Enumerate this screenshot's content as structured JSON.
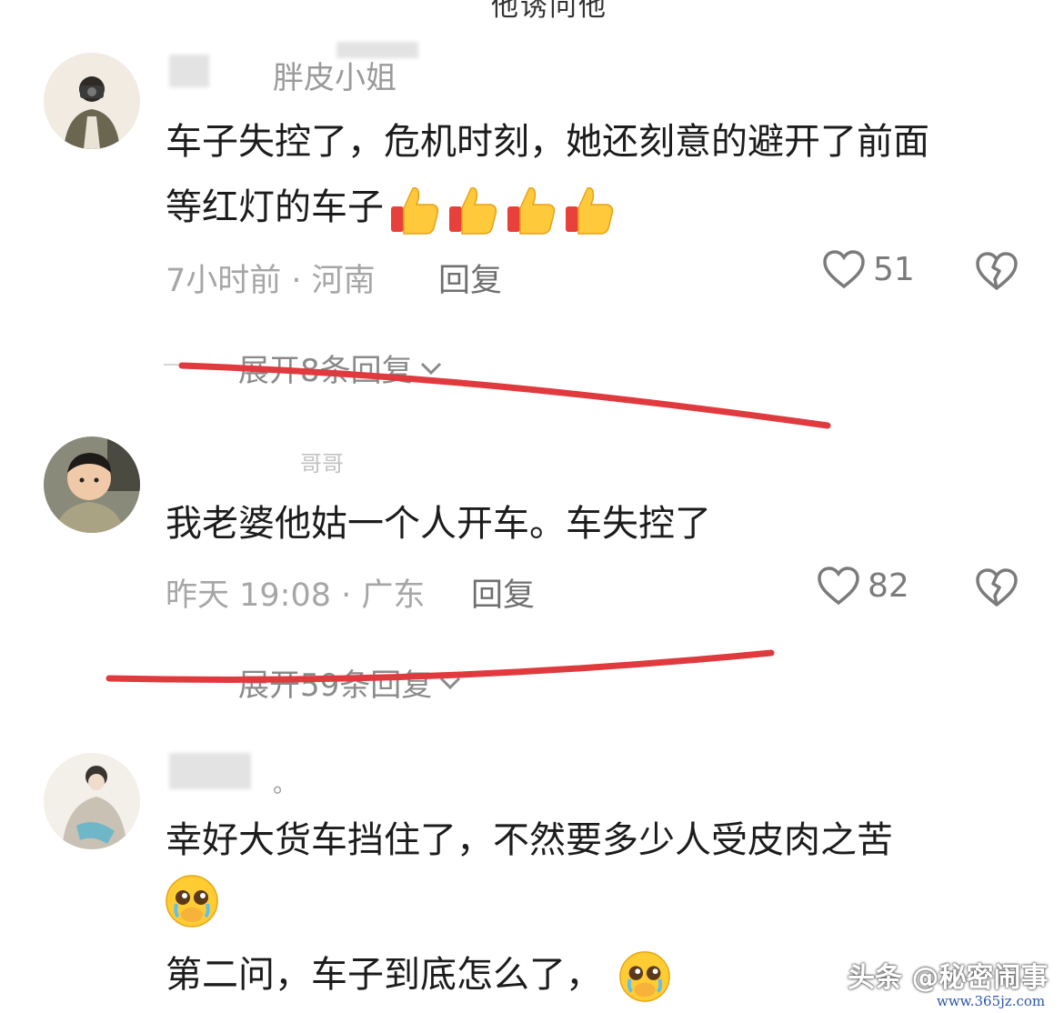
{
  "top_fragment": "他诱问他",
  "comments": [
    {
      "username": "胖皮小姐",
      "text_lines": [
        "车子失控了，危机时刻，她还刻意的避开了前面",
        "等红灯的车子"
      ],
      "emoji": "thumbs-up",
      "emoji_count": 4,
      "time_location": "7小时前 · 河南",
      "reply_label": "回复",
      "likes": "51",
      "expand_label": "展开8条回复"
    },
    {
      "username": "哥哥",
      "text_lines": [
        "我老婆他姑一个人开车。车失控了"
      ],
      "time_location": "昨天 19:08 · 广东",
      "reply_label": "回复",
      "likes": "82",
      "expand_label": "展开59条回复"
    },
    {
      "username": "。",
      "text_lines": [
        "幸好大货车挡住了，不然要多少人受皮肉之苦",
        "",
        "第二问，车子到底怎么了，"
      ],
      "emoji": "pleading-face"
    }
  ],
  "watermark": {
    "text": "头条 @秘密闹事",
    "url": "www.365jz.com"
  },
  "colors": {
    "annotation_red": "#e03a3e",
    "meta_gray": "#a6a6a6",
    "text_dark": "#1c1c1c"
  }
}
